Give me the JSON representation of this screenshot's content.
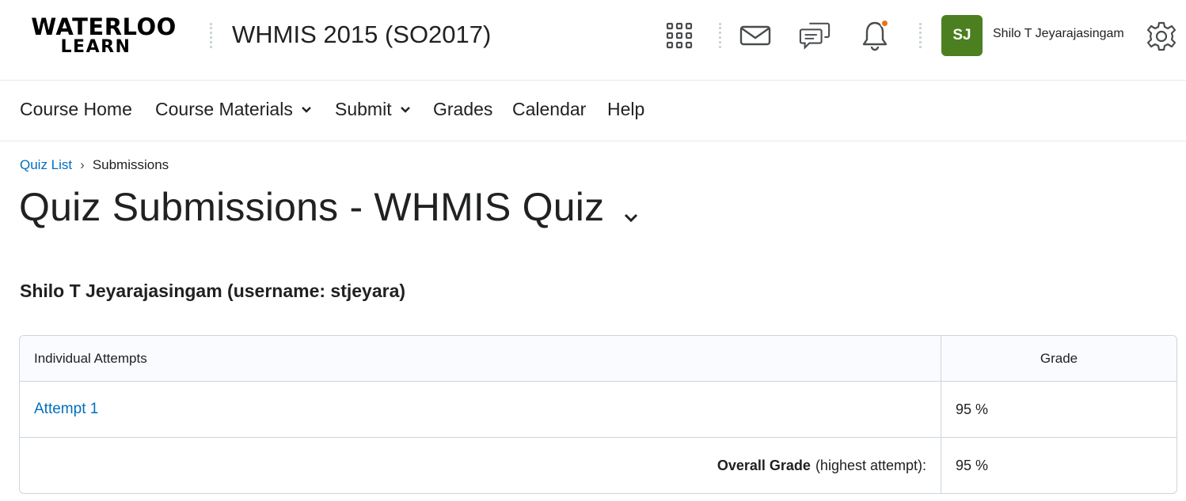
{
  "header": {
    "logo_line1": "WATERLOO",
    "logo_line2": "LEARN",
    "course_title": "WHMIS 2015 (SO2017)",
    "avatar_initials": "SJ",
    "user_name": "Shilo T Jeyarajasingam",
    "icons": [
      "waffle-icon",
      "mail-icon",
      "chat-icon",
      "bell-icon",
      "gear-icon"
    ],
    "avatar_color": "#4b7f20",
    "notification_color": "#e87511"
  },
  "nav": {
    "items": [
      {
        "label": "Course Home"
      },
      {
        "label": "Course Materials"
      },
      {
        "label": "Submit"
      },
      {
        "label": "Grades"
      },
      {
        "label": "Calendar"
      },
      {
        "label": "Help"
      }
    ]
  },
  "breadcrumb": {
    "parent": "Quiz List",
    "separator": "›",
    "current": "Submissions"
  },
  "page": {
    "title": "Quiz Submissions - WHMIS Quiz",
    "user_heading": "Shilo T Jeyarajasingam (username: stjeyara)"
  },
  "table": {
    "headers": [
      "Individual Attempts",
      "Grade"
    ],
    "attempts": [
      {
        "label": "Attempt 1",
        "grade": "95 %"
      }
    ],
    "overall_label_strong": "Overall Grade",
    "overall_label_rest": "(highest attempt):",
    "overall_grade": "95 %"
  },
  "colors": {
    "link": "#006fbf",
    "border": "#cdd5dc"
  }
}
